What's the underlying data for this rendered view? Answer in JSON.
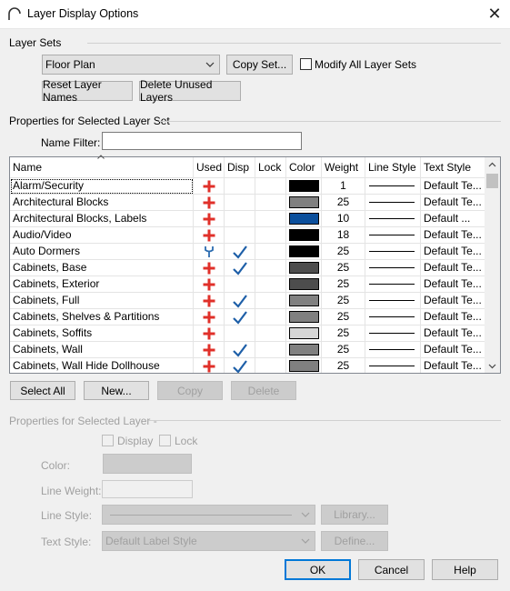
{
  "window": {
    "title": "Layer Display Options",
    "close_icon": "close-icon",
    "app_icon": "arch-icon"
  },
  "layer_sets": {
    "group_label": "Layer Sets",
    "selected": "Floor Plan",
    "copy_set_label": "Copy Set...",
    "modify_all_label": "Modify All Layer Sets",
    "modify_all_checked": false,
    "reset_names_label": "Reset Layer Names",
    "delete_unused_label": "Delete Unused Layers"
  },
  "properties_selected_set": {
    "group_label": "Properties for Selected Layer Set",
    "name_filter_label": "Name Filter:",
    "name_filter_value": ""
  },
  "table": {
    "columns": [
      "Name",
      "Used",
      "Disp",
      "Lock",
      "Color",
      "Weight",
      "Line Style",
      "Text Style"
    ],
    "rows": [
      {
        "name": "Alarm/Security",
        "used": "plus",
        "disp": false,
        "color": "#000000",
        "weight": "1",
        "text_style": "Default Te..."
      },
      {
        "name": "Architectural Blocks",
        "used": "plus",
        "disp": false,
        "color": "#808080",
        "weight": "25",
        "text_style": "Default Te..."
      },
      {
        "name": "Architectural Blocks, Labels",
        "used": "plus",
        "disp": false,
        "color": "#0b4f9c",
        "weight": "10",
        "text_style": "Default ..."
      },
      {
        "name": "Audio/Video",
        "used": "plus",
        "disp": false,
        "color": "#000000",
        "weight": "18",
        "text_style": "Default Te..."
      },
      {
        "name": "Auto Dormers",
        "used": "wrench",
        "disp": true,
        "color": "#000000",
        "weight": "25",
        "text_style": "Default Te..."
      },
      {
        "name": "Cabinets,  Base",
        "used": "plus",
        "disp": true,
        "color": "#4d4d4d",
        "weight": "25",
        "text_style": "Default Te..."
      },
      {
        "name": "Cabinets,  Exterior",
        "used": "plus",
        "disp": false,
        "color": "#4d4d4d",
        "weight": "25",
        "text_style": "Default Te..."
      },
      {
        "name": "Cabinets,  Full",
        "used": "plus",
        "disp": true,
        "color": "#808080",
        "weight": "25",
        "text_style": "Default Te..."
      },
      {
        "name": "Cabinets,  Shelves & Partitions",
        "used": "plus",
        "disp": true,
        "color": "#808080",
        "weight": "25",
        "text_style": "Default Te..."
      },
      {
        "name": "Cabinets,  Soffits",
        "used": "plus",
        "disp": false,
        "color": "#d6d6d6",
        "weight": "25",
        "text_style": "Default Te..."
      },
      {
        "name": "Cabinets,  Wall",
        "used": "plus",
        "disp": true,
        "color": "#808080",
        "weight": "25",
        "text_style": "Default Te..."
      },
      {
        "name": "Cabinets,  Wall Hide Dollhouse",
        "used": "plus",
        "disp": true,
        "color": "#808080",
        "weight": "25",
        "text_style": "Default Te..."
      }
    ]
  },
  "table_buttons": {
    "select_all": "Select All",
    "new": "New...",
    "copy": "Copy",
    "delete": "Delete"
  },
  "properties_selected_layer": {
    "group_label": "Properties for Selected Layer -",
    "display_label": "Display",
    "lock_label": "Lock",
    "color_label": "Color:",
    "line_weight_label": "Line Weight:",
    "line_style_label": "Line Style:",
    "library_label": "Library...",
    "text_style_label": "Text Style:",
    "text_style_value": "Default Label Style",
    "define_label": "Define..."
  },
  "footer": {
    "ok": "OK",
    "cancel": "Cancel",
    "help": "Help"
  },
  "colors": {
    "used_plus": "#e0302a",
    "check": "#1e5fa8",
    "wrench": "#2b6cb0",
    "accent": "#0078d7"
  }
}
